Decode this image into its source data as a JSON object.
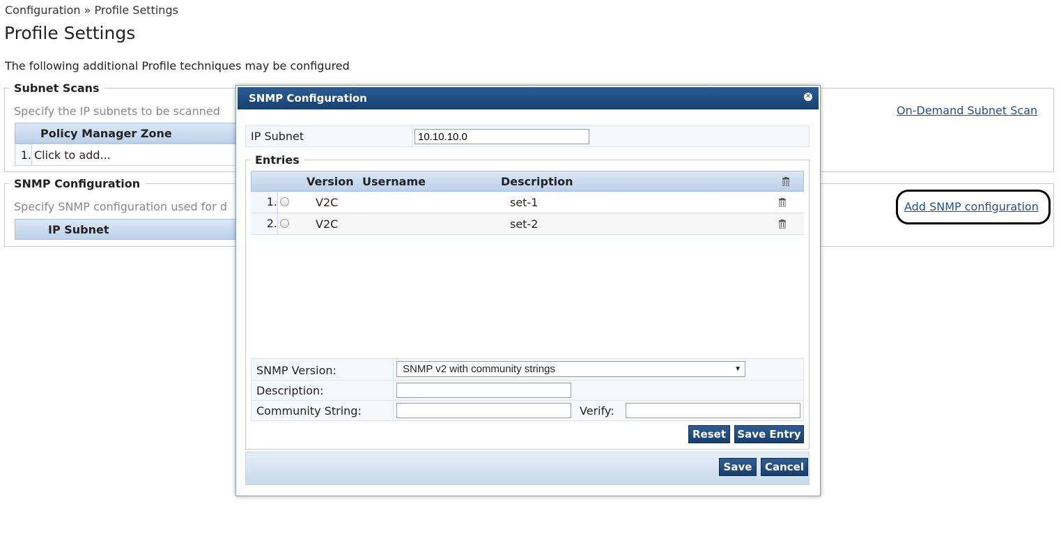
{
  "breadcrumb": "Configuration » Profile Settings",
  "page_title": "Profile Settings",
  "intro": "The following additional Profile techniques may be configured",
  "subnet_scans": {
    "legend": "Subnet Scans",
    "help": "Specify the IP subnets to be scanned",
    "column": "Policy Manager Zone",
    "row_num": "1.",
    "row_text": "Click to add...",
    "link": "On-Demand Subnet Scan"
  },
  "snmp_section": {
    "legend": "SNMP Configuration",
    "help": "Specify SNMP configuration used for d",
    "column": "IP Subnet",
    "link": "Add SNMP configuration"
  },
  "modal": {
    "title": "SNMP Configuration",
    "ip_subnet_label": "IP Subnet",
    "ip_subnet_value": "10.10.10.0",
    "entries_legend": "Entries",
    "columns": {
      "version": "Version",
      "username": "Username",
      "description": "Description"
    },
    "entries": [
      {
        "num": "1.",
        "version": "V2C",
        "username": "",
        "description": "set-1"
      },
      {
        "num": "2.",
        "version": "V2C",
        "username": "",
        "description": "set-2"
      }
    ],
    "snmp_version_label": "SNMP Version:",
    "snmp_version_value": "SNMP v2 with community strings",
    "description_label": "Description:",
    "description_value": "",
    "community_label": "Community String:",
    "community_value": "",
    "verify_label": "Verify:",
    "verify_value": "",
    "reset_label": "Reset",
    "save_entry_label": "Save Entry",
    "save_label": "Save",
    "cancel_label": "Cancel"
  },
  "colors": {
    "accent": "#1f4e9a",
    "header_dark": "#17416f",
    "grid_header": "#bcd1ea"
  }
}
